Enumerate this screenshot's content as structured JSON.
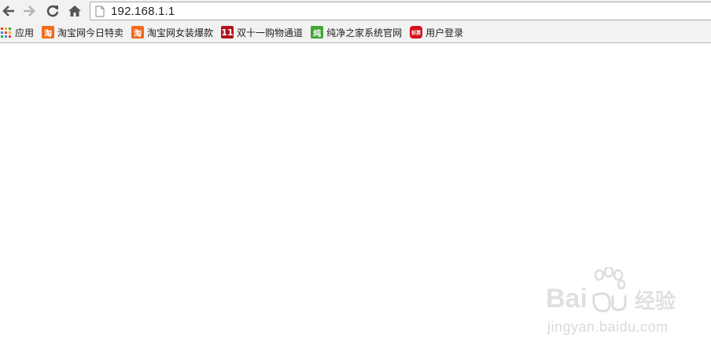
{
  "toolbar": {
    "url": "192.168.1.1",
    "back_icon": "back-arrow-icon",
    "forward_icon": "forward-arrow-icon",
    "reload_icon": "reload-icon",
    "home_icon": "home-icon"
  },
  "bookmarks": {
    "apps_label": "应用",
    "items": [
      {
        "label": "淘宝网今日特卖",
        "icon": "taobao-icon",
        "icon_text": "淘",
        "color": "#f26a1b"
      },
      {
        "label": "淘宝网女装爆款",
        "icon": "taobao-icon",
        "icon_text": "淘",
        "color": "#f26a1b"
      },
      {
        "label": "双十一购物通道",
        "icon": "double-eleven-icon",
        "icon_text": "11",
        "color": "#b5121b"
      },
      {
        "label": "纯净之家系统官网",
        "icon": "chunjing-icon",
        "icon_text": "纯",
        "color": "#3fa535"
      },
      {
        "label": "用户登录",
        "icon": "user-login-icon",
        "icon_text": "彩票",
        "color": "#d6111c"
      }
    ]
  },
  "watermark": {
    "logo_text_left": "Bai",
    "logo_text_right": "经验",
    "url": "jingyan.baidu.com"
  }
}
